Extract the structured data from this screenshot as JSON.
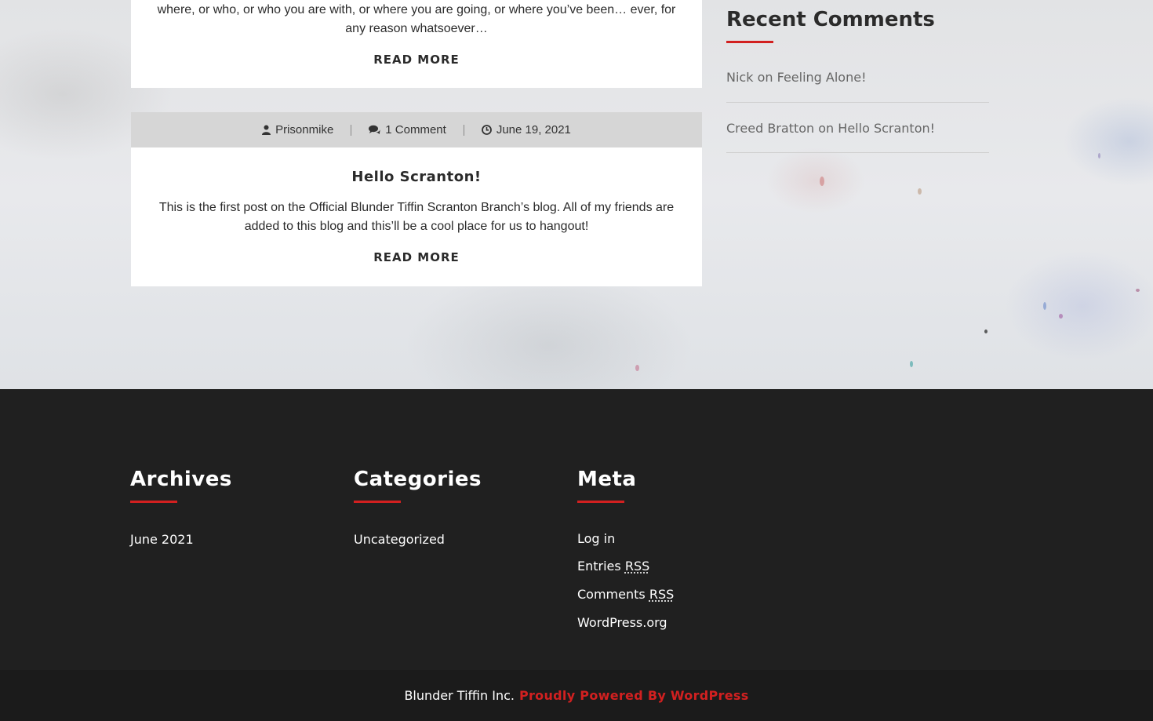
{
  "posts": [
    {
      "excerpt": "where, or who, or who you are with, or where you are going, or where you’ve been… ever, for any reason whatsoever…",
      "read_more": "READ MORE"
    },
    {
      "author": "Prisonmike",
      "comments": "1 Comment",
      "date": "June 19, 2021",
      "title": "Hello Scranton!",
      "excerpt": "This is the first post on the Official Blunder Tiffin Scranton Branch’s blog. All of my friends are added to this blog and this’ll be a cool place for us to hangout!",
      "read_more": "READ MORE"
    }
  ],
  "sidebar": {
    "recent_comments_title": "Recent Comments",
    "comments": [
      {
        "author": "Nick",
        "on": "on",
        "post": "Feeling Alone!"
      },
      {
        "author": "Creed Bratton",
        "on": "on",
        "post": "Hello Scranton!"
      }
    ]
  },
  "footer": {
    "archives": {
      "title": "Archives",
      "items": [
        "June 2021"
      ]
    },
    "categories": {
      "title": "Categories",
      "items": [
        "Uncategorized"
      ]
    },
    "meta": {
      "title": "Meta",
      "login": "Log in",
      "entries": "Entries",
      "comments": "Comments",
      "rss": "RSS",
      "wordpress": "WordPress.org"
    }
  },
  "bottom": {
    "copyright": "Blunder Tiffin Inc.",
    "powered": "Proudly Powered By WordPress"
  },
  "colors": {
    "accent": "#d22020",
    "footer_bg": "#202020",
    "meta_bar": "#d6d6d6"
  },
  "icons": {
    "author": "user-icon",
    "comments": "comments-icon",
    "date": "clock-icon"
  }
}
